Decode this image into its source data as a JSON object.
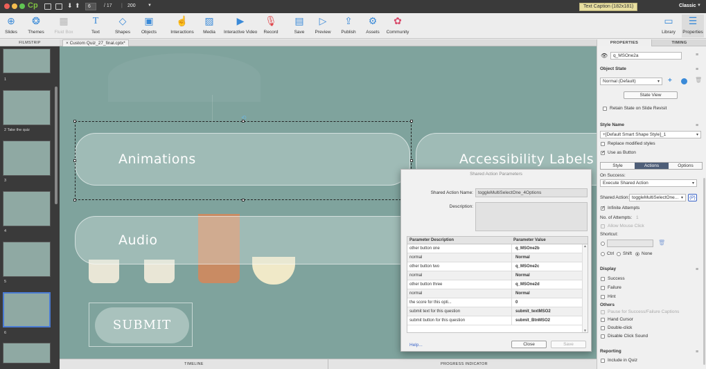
{
  "window": {
    "app_logo": "Cp",
    "slide_current": "6",
    "slide_total": "/ 17",
    "zoom": "200",
    "caption_badge": "Text Caption (182x181)",
    "mode": "Classic"
  },
  "toolbar": {
    "items": [
      {
        "label": "Slides",
        "icon": "slides-icon"
      },
      {
        "label": "Themes",
        "icon": "themes-icon"
      },
      {
        "label": "Fluid Box",
        "icon": "fluid-box-icon"
      },
      {
        "label": "Text",
        "icon": "text-icon"
      },
      {
        "label": "Shapes",
        "icon": "shapes-icon"
      },
      {
        "label": "Objects",
        "icon": "objects-icon"
      },
      {
        "label": "Interactions",
        "icon": "interactions-icon"
      },
      {
        "label": "Media",
        "icon": "media-icon"
      },
      {
        "label": "Interactive Video",
        "icon": "interactive-video-icon"
      },
      {
        "label": "Record",
        "icon": "record-icon"
      },
      {
        "label": "Save",
        "icon": "save-icon"
      },
      {
        "label": "Preview",
        "icon": "preview-icon"
      },
      {
        "label": "Publish",
        "icon": "publish-icon"
      },
      {
        "label": "Assets",
        "icon": "assets-icon"
      },
      {
        "label": "Community",
        "icon": "community-icon"
      },
      {
        "label": "Library",
        "icon": "library-icon"
      },
      {
        "label": "Properties",
        "icon": "properties-icon"
      }
    ]
  },
  "filmstrip": {
    "header": "FILMSTRIP",
    "slides": [
      {
        "label": "1"
      },
      {
        "label": "2 Take the quiz"
      },
      {
        "label": "3"
      },
      {
        "label": "4"
      },
      {
        "label": "5"
      },
      {
        "label": "6"
      }
    ]
  },
  "doc_tab": {
    "close": "×",
    "name": "Custom Quiz_27_final.cptx*"
  },
  "stage": {
    "pill1": "Animations",
    "pill2": "Accessibility Labels (",
    "pill3": "Audio",
    "submit": "SUBMIT"
  },
  "bottom": {
    "timeline": "TIMELINE",
    "progress": "PROGRESS INDICATOR"
  },
  "dialog": {
    "title": "Shared Action Parameters",
    "name_label": "Shared Action Name:",
    "name_value": "toggleMultiSelectOne_4Options",
    "desc_label": "Description:",
    "col1": "Parameter Description",
    "col2": "Parameter Value",
    "rows": [
      {
        "desc": "other button one",
        "value": "q_MSOne2b"
      },
      {
        "desc": "normal",
        "value": "Normal"
      },
      {
        "desc": "other button two",
        "value": "q_MSOne2c"
      },
      {
        "desc": "normal",
        "value": "Normal"
      },
      {
        "desc": "other button three",
        "value": "q_MSOne2d"
      },
      {
        "desc": "normal",
        "value": "Normal"
      },
      {
        "desc": "the score for this opti...",
        "value": "0"
      },
      {
        "desc": "submit text for this question",
        "value": "submit_textMSO2"
      },
      {
        "desc": "submit button for this question",
        "value": "submit_BtnMSO2"
      }
    ],
    "help": "Help...",
    "close": "Close",
    "save": "Save"
  },
  "panel": {
    "tab_properties": "PROPERTIES",
    "tab_timing": "TIMING",
    "object_name": "q_MSOne2a",
    "object_state_title": "Object State",
    "state_value": "Normal (Default)",
    "state_view": "State View",
    "retain_state": "Retain State on Slide Revisit",
    "style_name_title": "Style Name",
    "style_value": "+[Default Smart Shape Style]_1",
    "replace_styles": "Replace modified styles",
    "use_as_button": "Use as Button",
    "tabs": [
      "Style",
      "Actions",
      "Options"
    ],
    "on_success_label": "On Success:",
    "on_success_value": "Execute Shared Action",
    "shared_action_label": "Shared Action:",
    "shared_action_value": "toggleMultiSelectOne...",
    "param_btn": "{P}",
    "infinite_attempts": "Infinite Attempts",
    "attempts_label": "No. of Attempts:",
    "attempts_value": "1",
    "allow_mouse_click": "Allow Mouse Click",
    "shortcut_label": "Shortcut:",
    "ctrl": "Ctrl",
    "shift": "Shift",
    "none": "None",
    "display_title": "Display",
    "success": "Success",
    "failure": "Failure",
    "hint": "Hint",
    "others_title": "Others",
    "pause_captions": "Pause for Success/Failure Captions",
    "hand_cursor": "Hand Cursor",
    "double_click": "Double-click",
    "disable_sound": "Disable Click Sound",
    "reporting_title": "Reporting",
    "include_quiz": "Include in Quiz"
  }
}
